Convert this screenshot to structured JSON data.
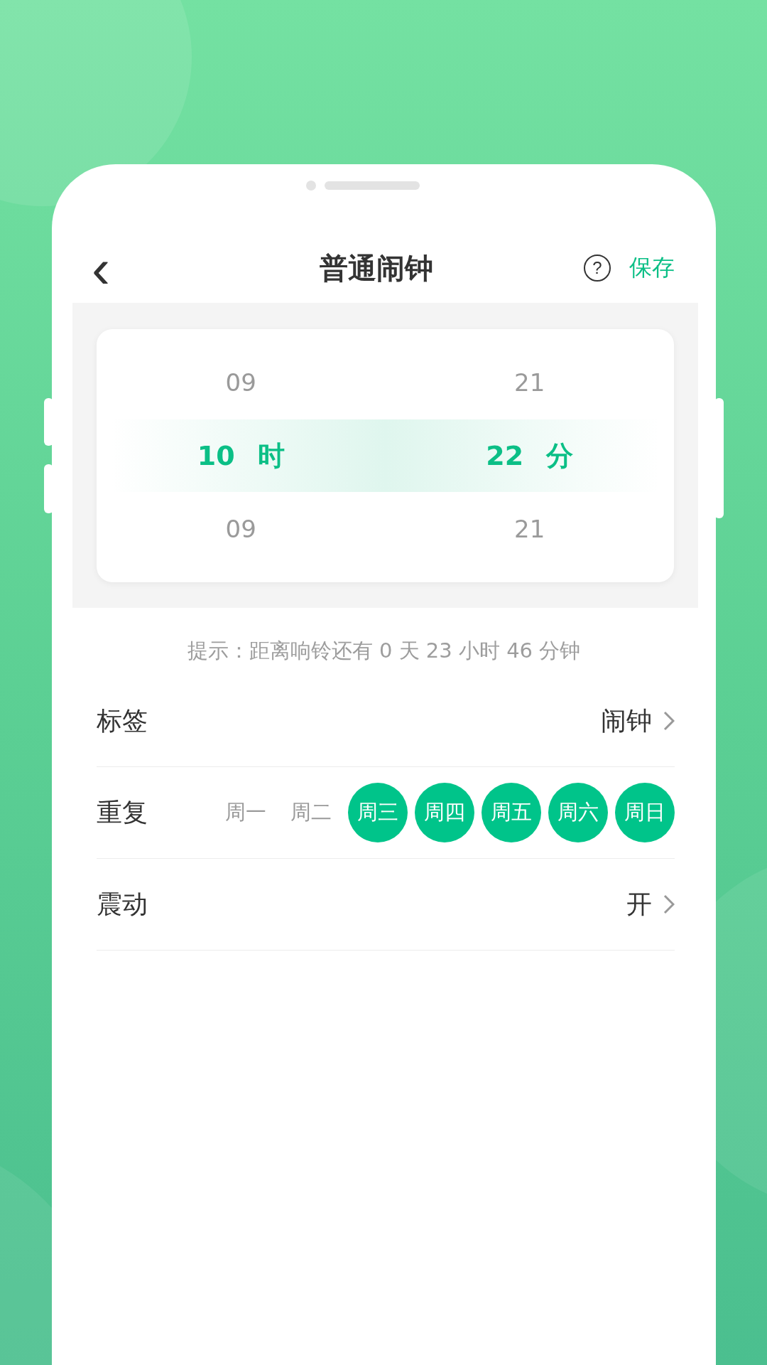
{
  "header": {
    "back": "‹",
    "title": "普通闹钟",
    "help": "?",
    "save": "保存"
  },
  "picker": {
    "columns": [
      {
        "items": [
          {
            "text": "09",
            "selected": false
          },
          {
            "text": "10",
            "selected": true
          },
          {
            "text": "09",
            "selected": false
          }
        ],
        "unit": "时"
      },
      {
        "items": [
          {
            "text": "21",
            "selected": false
          },
          {
            "text": "22",
            "selected": true
          },
          {
            "text": "21",
            "selected": false
          }
        ],
        "unit": "分"
      }
    ]
  },
  "hint": "提示：距离响铃还有 0 天 23 小时 46 分钟",
  "rows": [
    {
      "kind": "link",
      "label": "标签",
      "value": "闹钟"
    },
    {
      "kind": "days",
      "label": "重复",
      "days": [
        {
          "text": "周一",
          "selected": false
        },
        {
          "text": "周二",
          "selected": false
        },
        {
          "text": "周三",
          "selected": true
        },
        {
          "text": "周四",
          "selected": true
        },
        {
          "text": "周五",
          "selected": true
        },
        {
          "text": "周六",
          "selected": true
        },
        {
          "text": "周日",
          "selected": true
        }
      ]
    },
    {
      "kind": "link",
      "label": "震动",
      "value": "开"
    }
  ]
}
